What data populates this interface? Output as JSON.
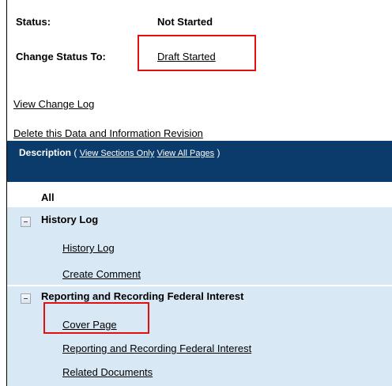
{
  "status": {
    "label": "Status:",
    "value": "Not Started"
  },
  "change_status": {
    "label": "Change Status To:",
    "option": "Draft Started"
  },
  "links": {
    "view_change_log": "View Change Log",
    "delete_revision": "Delete this Data and Information Revision"
  },
  "description": {
    "title": "Description",
    "open_paren": " ( ",
    "view_sections_only": "View Sections Only",
    "view_all_pages": "View All Pages",
    "close_paren": " )"
  },
  "tree": {
    "all_label": "All",
    "sections": [
      {
        "label": "History Log",
        "pages": [
          "History Log",
          "Create Comment"
        ]
      },
      {
        "label": "Reporting and Recording Federal Interest",
        "pages": [
          "Cover Page",
          "Reporting and Recording Federal Interest",
          "Related Documents"
        ]
      }
    ]
  },
  "colors": {
    "header_bg": "#0b3b6b",
    "section_bg": "#d9e8f5",
    "highlight_box": "#e01010"
  }
}
